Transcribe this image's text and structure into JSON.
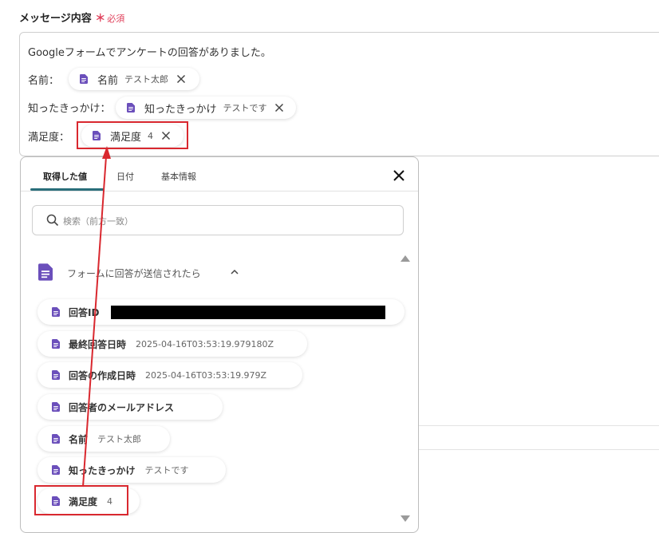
{
  "field": {
    "label": "メッセージ内容",
    "required_mark": "＊",
    "required_text": "必須"
  },
  "editor": {
    "line1": "Googleフォームでアンケートの回答がありました。",
    "line2_label": "名前：",
    "line3_label": "知ったきっかけ：",
    "line4_label": "満足度：",
    "chips": [
      {
        "label": "名前",
        "value": "テスト太郎"
      },
      {
        "label": "知ったきっかけ",
        "value": "テストです"
      },
      {
        "label": "満足度",
        "value": "4"
      }
    ]
  },
  "panel": {
    "tabs": [
      {
        "label": "取得した値"
      },
      {
        "label": "日付"
      },
      {
        "label": "基本情報"
      }
    ],
    "search_placeholder": "検索（前方一致）",
    "section_title": "フォームに回答が送信されたら",
    "items": [
      {
        "label": "回答ID",
        "value": ""
      },
      {
        "label": "最終回答日時",
        "value": "2025-04-16T03:53:19.979180Z"
      },
      {
        "label": "回答の作成日時",
        "value": "2025-04-16T03:53:19.979Z"
      },
      {
        "label": "回答者のメールアドレス",
        "value": ""
      },
      {
        "label": "名前",
        "value": "テスト太郎"
      },
      {
        "label": "知ったきっかけ",
        "value": "テストです"
      },
      {
        "label": "満足度",
        "value": "4"
      }
    ]
  },
  "colors": {
    "accent_tab": "#2a6e7a",
    "doc_icon": "#6b4fbb",
    "highlight": "#d9282f",
    "required": "#e0405b"
  }
}
